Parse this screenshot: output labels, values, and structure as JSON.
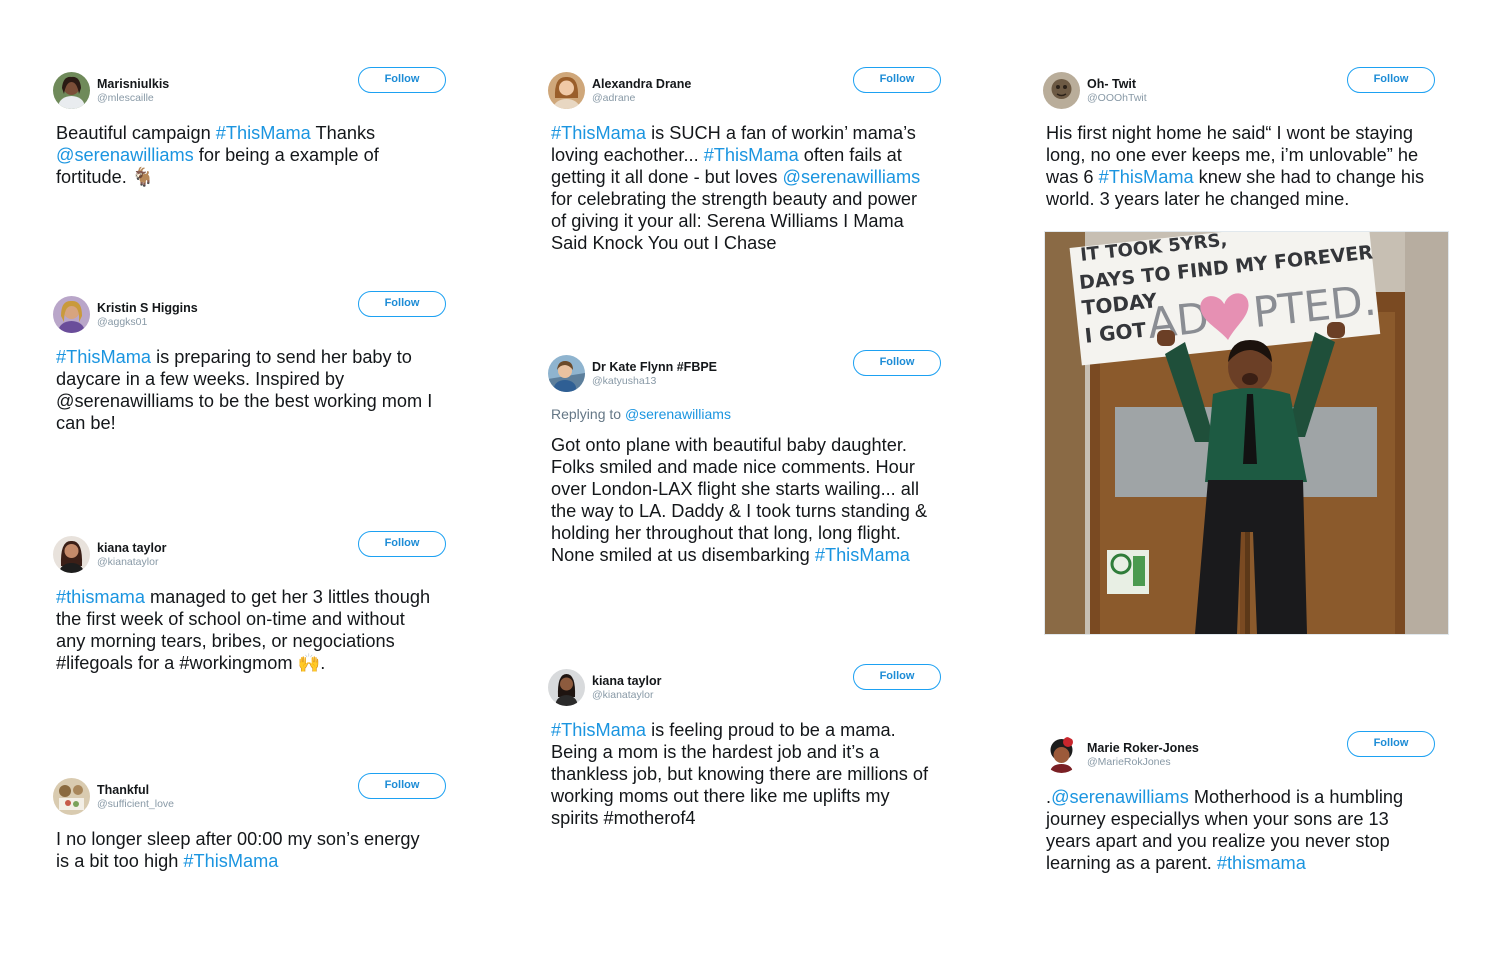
{
  "follow_label": "Follow",
  "colors": {
    "link": "#1b95e0",
    "follow_border": "#1da1f2",
    "name": "#14171a",
    "handle": "#8899a6"
  },
  "tweets": [
    {
      "name": "Marisniulkis",
      "handle": "@mlescaille",
      "lines": [
        [
          {
            "t": "Beautiful campaign "
          },
          {
            "t": "#ThisMama",
            "hl": true
          },
          {
            "t": " Thanks"
          }
        ],
        [
          {
            "t": "@serenawilliams",
            "hl": true
          },
          {
            "t": " for being a example of"
          }
        ],
        [
          {
            "t": "fortitude. 🐐"
          }
        ]
      ]
    },
    {
      "name": "Kristin S Higgins",
      "handle": "@aggks01",
      "lines": [
        [
          {
            "t": "#ThisMama",
            "hl": true
          },
          {
            "t": " is preparing to send her baby to"
          }
        ],
        [
          {
            "t": "daycare in a few weeks. Inspired by"
          }
        ],
        [
          {
            "t": "@serenawilliams to be the best working mom I"
          }
        ],
        [
          {
            "t": "can be!"
          }
        ]
      ]
    },
    {
      "name": "kiana taylor",
      "handle": "@kianataylor",
      "lines": [
        [
          {
            "t": "#thismama",
            "hl": true
          },
          {
            "t": " managed to get her 3 littles though"
          }
        ],
        [
          {
            "t": "the first week of school on-time and without"
          }
        ],
        [
          {
            "t": "any morning tears, bribes, or negociations"
          }
        ],
        [
          {
            "t": "#lifegoals for a #workingmom 🙌."
          }
        ]
      ]
    },
    {
      "name": "Thankful",
      "handle": "@sufficient_love",
      "lines": [
        [
          {
            "t": "I no longer sleep after 00:00 my son’s energy"
          }
        ],
        [
          {
            "t": "is a bit too high "
          },
          {
            "t": "#ThisMama",
            "hl": true
          }
        ]
      ]
    },
    {
      "name": "Alexandra Drane",
      "handle": "@adrane",
      "lines": [
        [
          {
            "t": "#ThisMama",
            "hl": true
          },
          {
            "t": " is SUCH a fan of workin’ mama’s"
          }
        ],
        [
          {
            "t": "loving eachother... "
          },
          {
            "t": "#ThisMama",
            "hl": true
          },
          {
            "t": " often fails at"
          }
        ],
        [
          {
            "t": "getting it all done - but loves "
          },
          {
            "t": "@serenawilliams",
            "hl": true
          }
        ],
        [
          {
            "t": "for celebrating the strength beauty and power"
          }
        ],
        [
          {
            "t": "of giving it your all: Serena Williams I Mama"
          }
        ],
        [
          {
            "t": "Said Knock You out I Chase"
          }
        ]
      ]
    },
    {
      "name": "Dr Kate Flynn #FBPE",
      "handle": "@katyusha13",
      "replying_prefix": "Replying to ",
      "replying_to": "@serenawilliams",
      "lines": [
        [
          {
            "t": "Got onto plane with beautiful baby daughter."
          }
        ],
        [
          {
            "t": "Folks smiled and made nice comments.  Hour"
          }
        ],
        [
          {
            "t": "over London-LAX flight she starts wailing... all"
          }
        ],
        [
          {
            "t": "the way to LA. Daddy & I took turns standing &"
          }
        ],
        [
          {
            "t": "holding her throughout that long, long flight."
          }
        ],
        [
          {
            "t": "None smiled at us disembarking "
          },
          {
            "t": "#ThisMama",
            "hl": true
          }
        ]
      ]
    },
    {
      "name": "kiana taylor",
      "handle": "@kianataylor",
      "lines": [
        [
          {
            "t": "#ThisMama",
            "hl": true
          },
          {
            "t": " is feeling proud to be a mama."
          }
        ],
        [
          {
            "t": "Being a mom is the hardest job and it’s a"
          }
        ],
        [
          {
            "t": "thankless job, but knowing there are millions of"
          }
        ],
        [
          {
            "t": "working moms out there like me uplifts my"
          }
        ],
        [
          {
            "t": "spirits #motherof4"
          }
        ]
      ]
    },
    {
      "name": "Oh- Twit",
      "handle": "@OOOhTwit",
      "lines": [
        [
          {
            "t": "His first night home he said“ I wont be staying"
          }
        ],
        [
          {
            "t": "long, no one ever keeps me, i’m unlovable” he"
          }
        ],
        [
          {
            "t": "was 6 "
          },
          {
            "t": "#ThisMama",
            "hl": true
          },
          {
            "t": " knew she had to change his"
          }
        ],
        [
          {
            "t": "world. 3 years later he changed mine."
          }
        ]
      ],
      "photo_sign": [
        "IT TOOK 5YRS,",
        "DAYS TO FIND MY FOREVER",
        "TODAY",
        "I GOT",
        "AD",
        "PTED."
      ]
    },
    {
      "name": "Marie Roker-Jones",
      "handle": "@MarieRokJones",
      "lines": [
        [
          {
            "t": "."
          },
          {
            "t": "@serenawilliams",
            "hl": true
          },
          {
            "t": " Motherhood is a humbling"
          }
        ],
        [
          {
            "t": "journey especiallys when your sons are 13"
          }
        ],
        [
          {
            "t": "years apart and you realize you never stop"
          }
        ],
        [
          {
            "t": "learning as a parent. "
          },
          {
            "t": "#thismama",
            "hl": true
          }
        ]
      ]
    }
  ]
}
